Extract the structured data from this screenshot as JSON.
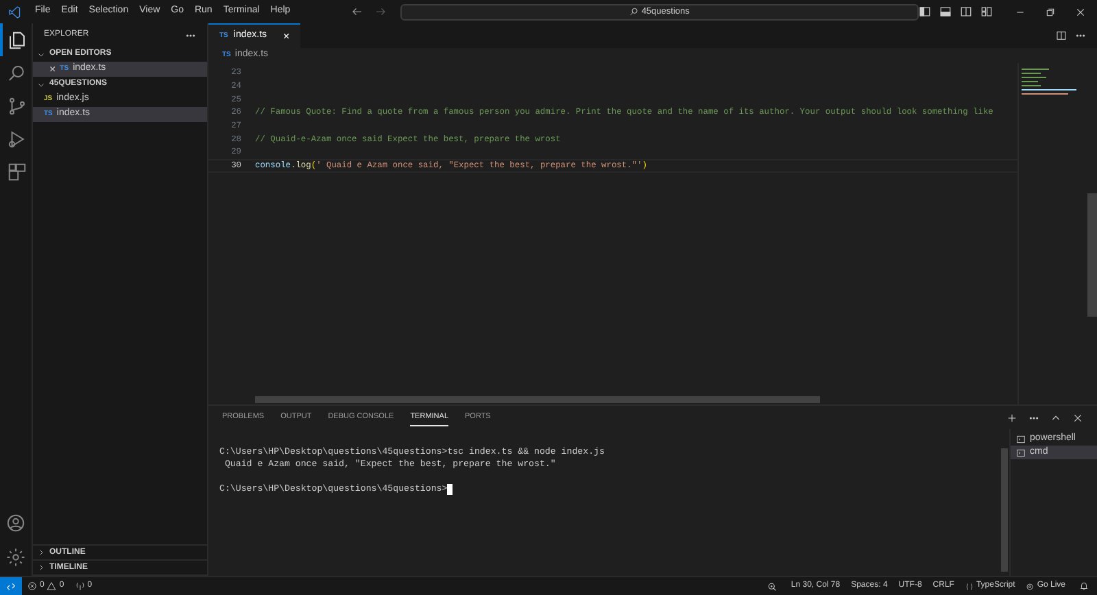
{
  "menu": [
    "File",
    "Edit",
    "Selection",
    "View",
    "Go",
    "Run",
    "Terminal",
    "Help"
  ],
  "search": "45questions",
  "activity": [
    {
      "selected": true
    },
    {
      "selected": false
    },
    {
      "selected": false
    },
    {
      "selected": false
    },
    {
      "selected": false
    }
  ],
  "sidebar": {
    "title": "EXPLORER",
    "sections": [
      {
        "label": "OPEN EDITORS",
        "expanded": true,
        "items": [
          {
            "badge": "TS",
            "name": "index.ts",
            "kind": "ts",
            "close": "×",
            "selected": true
          }
        ]
      },
      {
        "label": "45QUESTIONS",
        "expanded": true,
        "items": [
          {
            "badge": "JS",
            "name": "index.js",
            "kind": "js",
            "selected": false
          },
          {
            "badge": "TS",
            "name": "index.ts",
            "kind": "ts",
            "selected": true
          }
        ]
      }
    ],
    "bottom_sections": [
      {
        "label": "OUTLINE",
        "expanded": false
      },
      {
        "label": "TIMELINE",
        "expanded": false
      }
    ]
  },
  "tabs": [
    {
      "badge": "TS",
      "label": "index.ts",
      "close": "×",
      "selected": true
    }
  ],
  "breadcrumb": {
    "badge": "TS",
    "label": "index.ts"
  },
  "code": [
    {
      "number": "23",
      "current": false
    },
    {
      "number": "24",
      "current": false
    },
    {
      "number": "25",
      "current": false
    },
    {
      "number": "26",
      "current": false,
      "tokens": [
        {
          "kind": "comment",
          "text": "// Famous Quote: Find a quote from a famous person you admire. Print the quote and the name of its author. Your output should look something like"
        }
      ]
    },
    {
      "number": "27",
      "current": false
    },
    {
      "number": "28",
      "current": false,
      "tokens": [
        {
          "kind": "comment",
          "text": "// Quaid-e-Azam once said Expect the best, prepare the wrost"
        }
      ]
    },
    {
      "number": "29",
      "current": false
    },
    {
      "number": "30",
      "current": true,
      "tokens": [
        {
          "kind": "variable",
          "text": "console"
        },
        {
          "kind": "function",
          "text": ".log"
        },
        {
          "kind": "bracket",
          "text": "("
        },
        {
          "kind": "string",
          "text": "' Quaid e Azam once said, \"Expect the best, prepare the wrost.\"'"
        },
        {
          "kind": "bracket",
          "text": ")"
        }
      ]
    }
  ],
  "panel": {
    "tabs": [
      {
        "label": "PROBLEMS",
        "selected": false
      },
      {
        "label": "OUTPUT",
        "selected": false
      },
      {
        "label": "DEBUG CONSOLE",
        "selected": false
      },
      {
        "label": "TERMINAL",
        "selected": true
      },
      {
        "label": "PORTS",
        "selected": false
      }
    ],
    "terminal": {
      "output": [
        "C:\\Users\\HP\\Desktop\\questions\\45questions>tsc index.ts && node index.js",
        " Quaid e Azam once said, \"Expect the best, prepare the wrost.\""
      ],
      "prompt": "C:\\Users\\HP\\Desktop\\questions\\45questions>"
    },
    "shells": [
      {
        "label": "powershell",
        "selected": false
      },
      {
        "label": "cmd",
        "selected": true
      }
    ]
  },
  "status": {
    "errors": "0",
    "warnings": "0",
    "ports": "0",
    "right": [
      "Ln 30, Col 78",
      "Spaces: 4",
      "UTF-8",
      "CRLF",
      "TypeScript",
      "Go Live"
    ]
  }
}
